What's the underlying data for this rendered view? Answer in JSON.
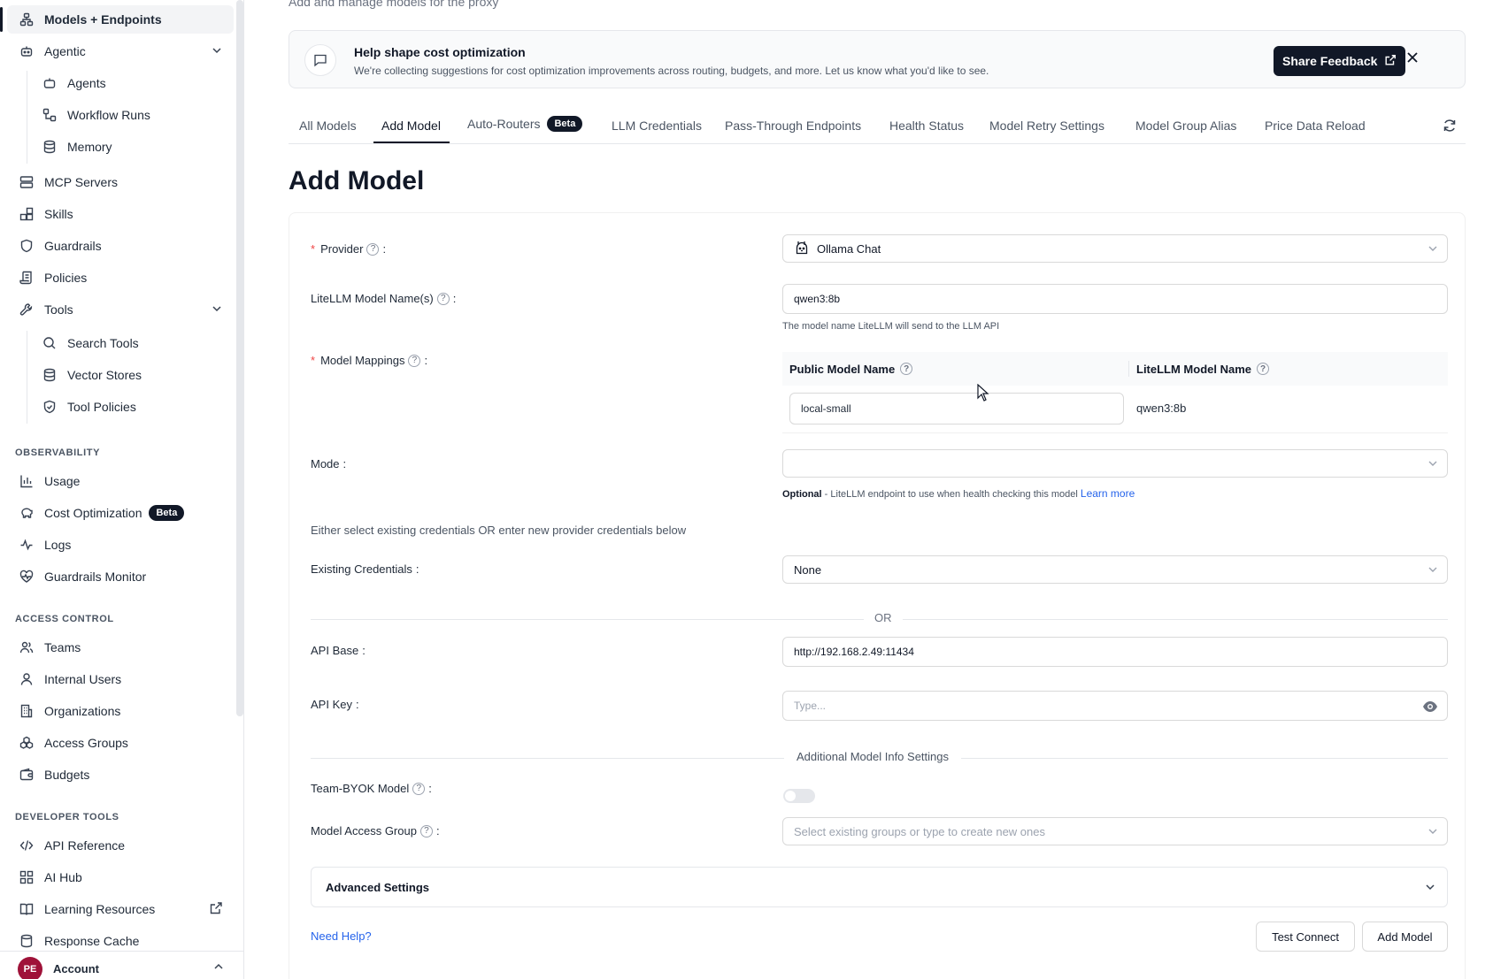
{
  "sidebar": {
    "items": {
      "models": "Models + Endpoints",
      "agentic": "Agentic",
      "agents": "Agents",
      "workflow_runs": "Workflow Runs",
      "memory": "Memory",
      "mcp_servers": "MCP Servers",
      "skills": "Skills",
      "guardrails": "Guardrails",
      "policies": "Policies",
      "tools": "Tools",
      "search_tools": "Search Tools",
      "vector_stores": "Vector Stores",
      "tool_policies": "Tool Policies",
      "usage": "Usage",
      "cost_optimization": "Cost Optimization",
      "cost_badge": "Beta",
      "logs": "Logs",
      "guardrails_monitor": "Guardrails Monitor",
      "teams": "Teams",
      "internal_users": "Internal Users",
      "organizations": "Organizations",
      "access_groups": "Access Groups",
      "budgets": "Budgets",
      "api_reference": "API Reference",
      "ai_hub": "AI Hub",
      "learning_resources": "Learning Resources",
      "response_cache": "Response Cache"
    },
    "sections": {
      "observability": "OBSERVABILITY",
      "access_control": "ACCESS CONTROL",
      "developer_tools": "DEVELOPER TOOLS"
    },
    "account": {
      "initials": "PE",
      "label": "Account"
    }
  },
  "header": {
    "subtitle": "Add and manage models for the proxy"
  },
  "banner": {
    "title": "Help shape cost optimization",
    "description": "We're collecting suggestions for cost optimization improvements across routing, budgets, and more. Let us know what you'd like to see.",
    "share_label": "Share Feedback"
  },
  "tabs": [
    {
      "label": "All Models"
    },
    {
      "label": "Add Model"
    },
    {
      "label": "Auto-Routers",
      "badge": "Beta"
    },
    {
      "label": "LLM Credentials"
    },
    {
      "label": "Pass-Through Endpoints"
    },
    {
      "label": "Health Status"
    },
    {
      "label": "Model Retry Settings"
    },
    {
      "label": "Model Group Alias"
    },
    {
      "label": "Price Data Reload"
    }
  ],
  "page_title": "Add Model",
  "form": {
    "provider_label": "Provider",
    "provider_value": "Ollama Chat",
    "model_name_label": "LiteLLM Model Name(s)",
    "model_name_value": "qwen3:8b",
    "model_name_help": "The model name LiteLLM will send to the LLM API",
    "mappings_label": "Model Mappings",
    "mappings_col_public": "Public Model Name",
    "mappings_col_litellm": "LiteLLM Model Name",
    "mappings_public_value": "local-small",
    "mappings_litellm_value": "qwen3:8b",
    "mode_label": "Mode",
    "mode_help_bold": "Optional",
    "mode_help_text": " - LiteLLM endpoint to use when health checking this model ",
    "mode_help_link": "Learn more",
    "credentials_note": "Either select existing credentials OR enter new provider credentials below",
    "existing_credentials_label": "Existing Credentials",
    "existing_credentials_value": "None",
    "or_text": "OR",
    "api_base_label": "API Base",
    "api_base_value": "http://192.168.2.49:11434",
    "api_key_label": "API Key",
    "api_key_placeholder": "Type...",
    "additional_settings": "Additional Model Info Settings",
    "team_byok_label": "Team-BYOK Model",
    "access_group_label": "Model Access Group",
    "access_group_placeholder": "Select existing groups or type to create new ones",
    "advanced_settings": "Advanced Settings",
    "need_help": "Need Help?",
    "test_connect": "Test Connect",
    "add_model": "Add Model"
  }
}
